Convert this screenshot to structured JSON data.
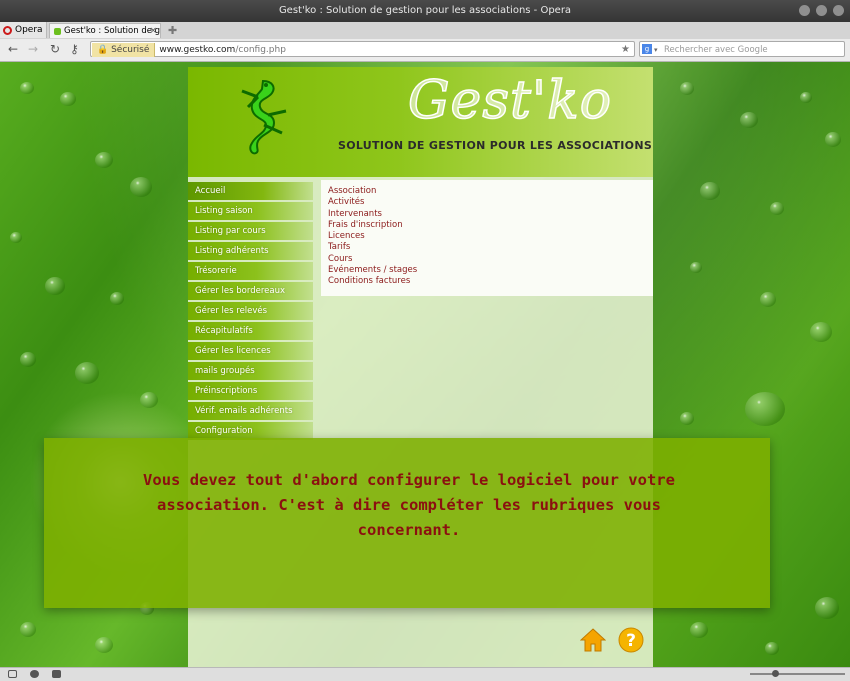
{
  "window": {
    "title": "Gest'ko : Solution de gestion pour les associations - Opera"
  },
  "browser": {
    "menu_label": "Opera",
    "tab_title": "Gest'ko : Solution de g...",
    "secure_label": "Sécurisé",
    "url_host": "www.gestko.com",
    "url_path": "/config.php",
    "search_placeholder": "Rechercher avec Google"
  },
  "site": {
    "title": "Gest'ko",
    "tagline": "SOLUTION DE GESTION POUR LES ASSOCIATIONS"
  },
  "menu": [
    {
      "label": "Accueil",
      "active": true
    },
    {
      "label": "Listing saison"
    },
    {
      "label": "Listing par cours"
    },
    {
      "label": "Listing adhérents"
    },
    {
      "label": "Trésorerie"
    },
    {
      "label": "Gérer les bordereaux"
    },
    {
      "label": "Gérer les relevés"
    },
    {
      "label": "Récapitulatifs"
    },
    {
      "label": "Gérer les licences"
    },
    {
      "label": "mails groupés"
    },
    {
      "label": "Préinscriptions"
    },
    {
      "label": "Vérif. emails adhérents"
    },
    {
      "label": "Configuration"
    }
  ],
  "submenu": [
    "Association",
    "Activités",
    "Intervenants",
    "Frais d'inscription",
    "Licences",
    "Tarifs",
    "Cours",
    "Evénements / stages",
    "Conditions factures"
  ],
  "overlay": {
    "message": "Vous devez tout d'abord configurer le logiciel pour votre association. C'est à dire compléter les rubriques vous concernant."
  },
  "colors": {
    "menu_green": "#8cc11c",
    "link_red": "#8b1a1a",
    "overlay_green": "#7daf00",
    "icon_orange": "#f5a400"
  }
}
